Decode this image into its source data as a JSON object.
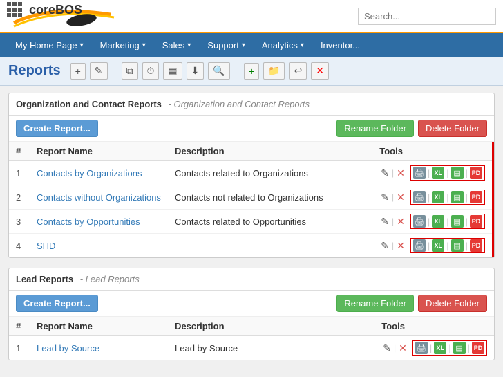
{
  "app": {
    "name": "coreBOS",
    "search_placeholder": "Search..."
  },
  "nav": {
    "items": [
      {
        "label": "My Home Page",
        "has_arrow": true
      },
      {
        "label": "Marketing",
        "has_arrow": true
      },
      {
        "label": "Sales",
        "has_arrow": true
      },
      {
        "label": "Support",
        "has_arrow": true
      },
      {
        "label": "Analytics",
        "has_arrow": true
      },
      {
        "label": "Inventor...",
        "has_arrow": false
      }
    ]
  },
  "page": {
    "title": "Reports",
    "toolbar": {
      "add": "+",
      "edit": "✎",
      "copy": "⧉",
      "clock": "⏱",
      "table": "▦",
      "download": "⬇",
      "search": "🔍",
      "green_plus": "+",
      "folder": "📁",
      "undo": "↩",
      "delete": "✕"
    }
  },
  "folders": [
    {
      "id": "org-contact",
      "title": "Organization and Contact Reports",
      "subtitle": "Organization and Contact Reports",
      "create_label": "Create Report...",
      "rename_label": "Rename Folder",
      "delete_label": "Delete Folder",
      "columns": [
        "#",
        "Report Name",
        "Description",
        "Tools"
      ],
      "reports": [
        {
          "num": "1",
          "name": "Contacts by Organizations",
          "description": "Contacts related to Organizations"
        },
        {
          "num": "2",
          "name": "Contacts without Organizations",
          "description": "Contacts not related to Organizations"
        },
        {
          "num": "3",
          "name": "Contacts by Opportunities",
          "description": "Contacts related to Opportunities"
        },
        {
          "num": "4",
          "name": "SHD",
          "description": ""
        }
      ]
    },
    {
      "id": "lead",
      "title": "Lead Reports",
      "subtitle": "Lead Reports",
      "create_label": "Create Report...",
      "rename_label": "Rename Folder",
      "delete_label": "Delete Folder",
      "columns": [
        "#",
        "Report Name",
        "Description",
        "Tools"
      ],
      "reports": [
        {
          "num": "1",
          "name": "Lead by Source",
          "description": "Lead by Source"
        }
      ]
    }
  ]
}
